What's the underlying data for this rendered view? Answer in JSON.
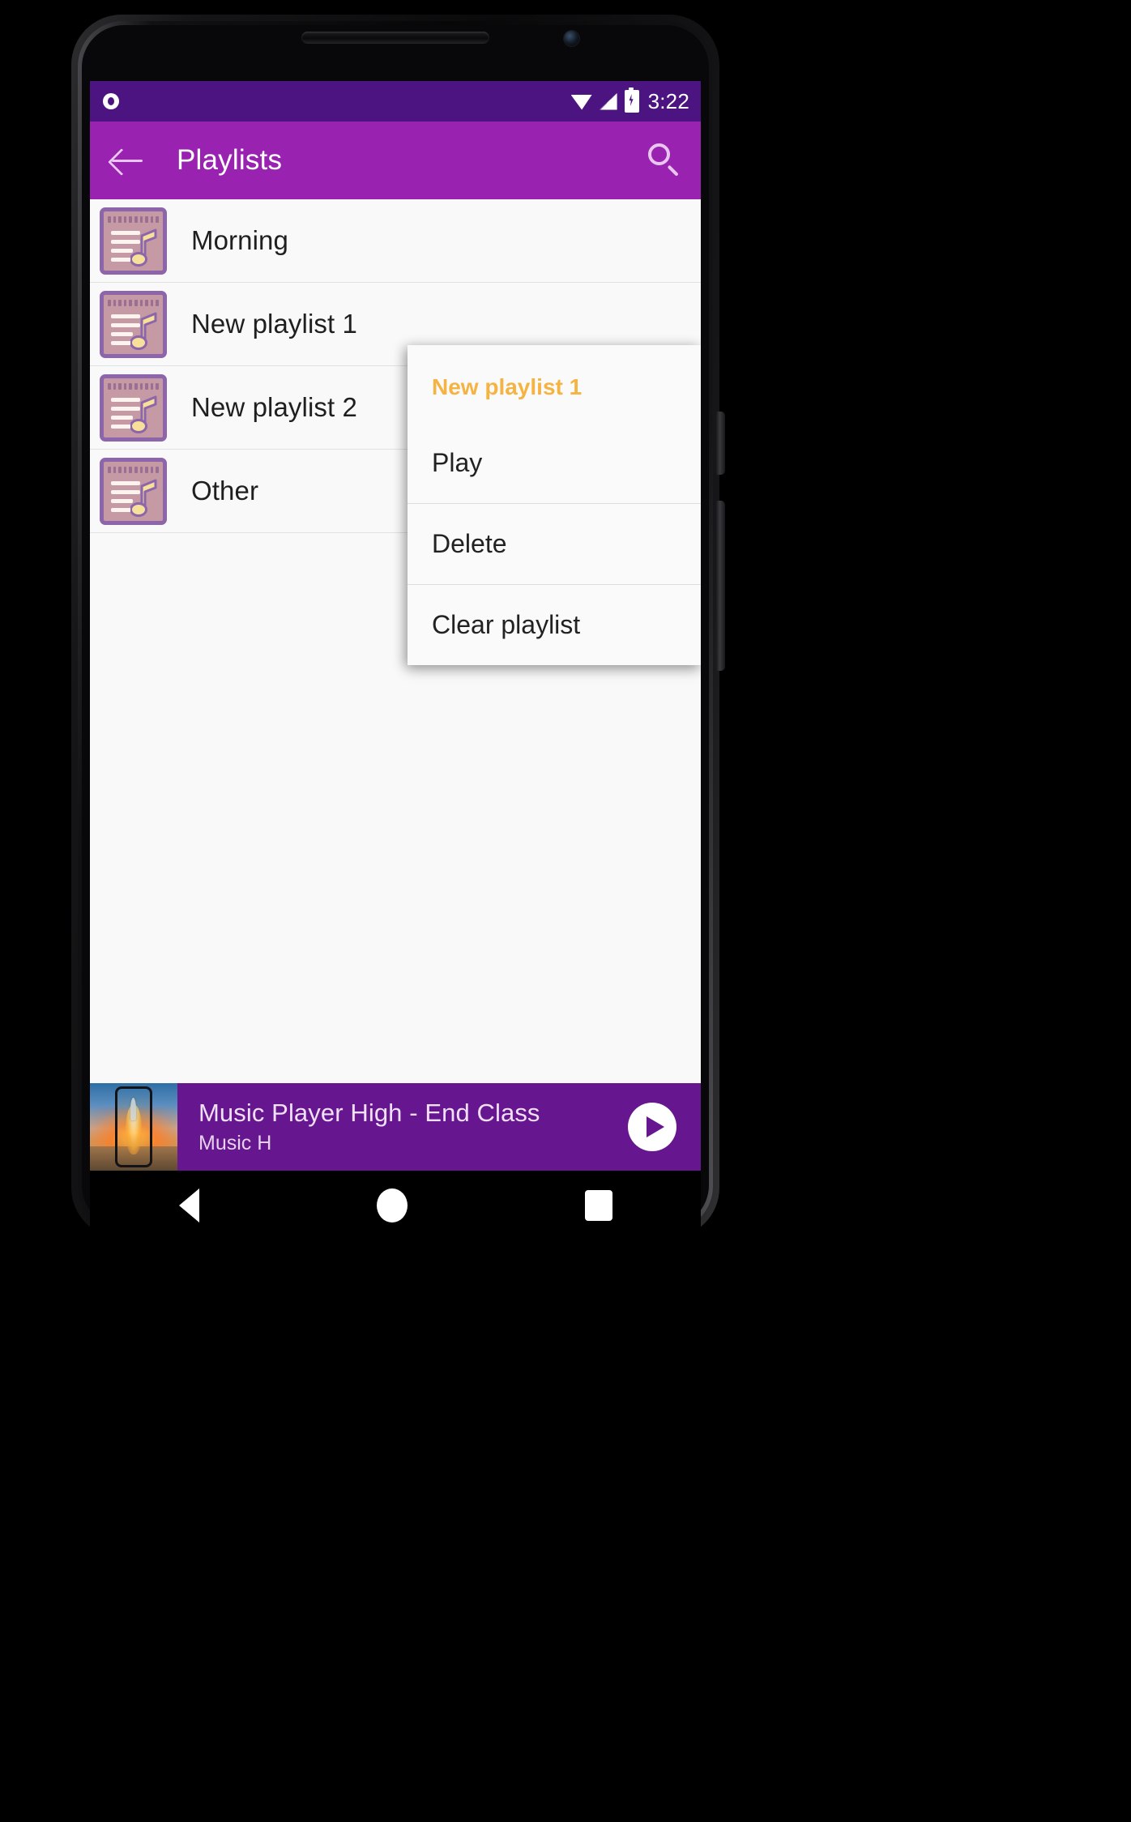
{
  "status_bar": {
    "time": "3:22",
    "icons": [
      "record-icon",
      "wifi-icon",
      "signal-icon",
      "battery-charging-icon"
    ],
    "background": "#4B1480"
  },
  "app_bar": {
    "title": "Playlists",
    "back_icon": "back-arrow-icon",
    "search_icon": "search-icon",
    "background": "#9A22B0"
  },
  "playlists": [
    {
      "name": "Morning",
      "icon": "playlist-note-icon"
    },
    {
      "name": "New playlist 1",
      "icon": "playlist-note-icon"
    },
    {
      "name": "New playlist 2",
      "icon": "playlist-note-icon"
    },
    {
      "name": "Other",
      "icon": "playlist-note-icon"
    }
  ],
  "context_menu": {
    "header": "New playlist 1",
    "header_color": "#F5B342",
    "items": [
      {
        "label": "Play"
      },
      {
        "label": "Delete"
      },
      {
        "label": "Clear playlist"
      }
    ]
  },
  "now_playing": {
    "title": "Music Player High - End Class",
    "artist": "Music H",
    "play_icon": "play-circle-icon",
    "album_art": "rocket-launch-artwork",
    "background": "#66168E"
  },
  "nav_bar": {
    "back": "nav-back-triangle-icon",
    "home": "nav-home-circle-icon",
    "recents": "nav-recents-square-icon"
  }
}
